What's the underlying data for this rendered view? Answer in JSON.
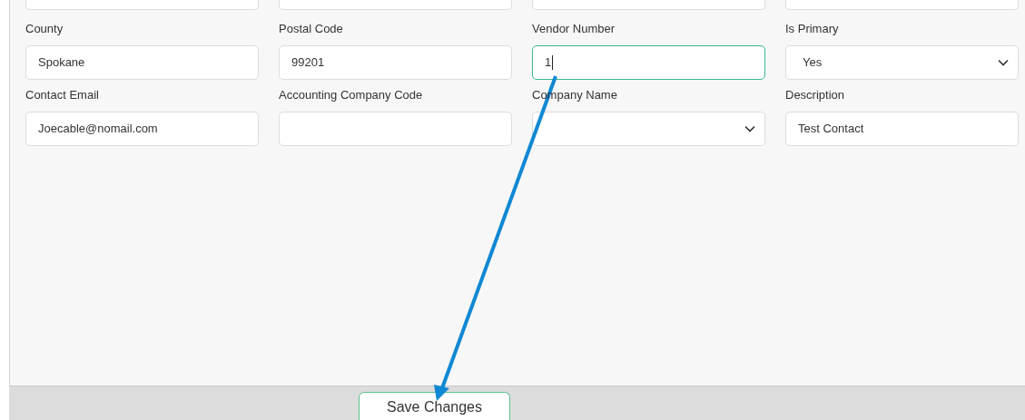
{
  "fields": [
    {
      "label": "County",
      "value": "Spokane",
      "kind": "text",
      "focused": false
    },
    {
      "label": "Postal Code",
      "value": "99201",
      "kind": "text",
      "focused": false
    },
    {
      "label": "Vendor Number",
      "value": "1",
      "kind": "text",
      "focused": true
    },
    {
      "label": "Is Primary",
      "value": "Yes",
      "kind": "select",
      "focused": false
    },
    {
      "label": "Contact Email",
      "value": "Joecable@nomail.com",
      "kind": "text",
      "focused": false
    },
    {
      "label": "Accounting Company Code",
      "kind": "text",
      "focused": false
    },
    {
      "label": "Company Name",
      "kind": "select",
      "focused": false
    },
    {
      "label": "Description",
      "value": "Test Contact",
      "kind": "text",
      "focused": false
    }
  ],
  "footer": {
    "button": "Save Changes"
  }
}
